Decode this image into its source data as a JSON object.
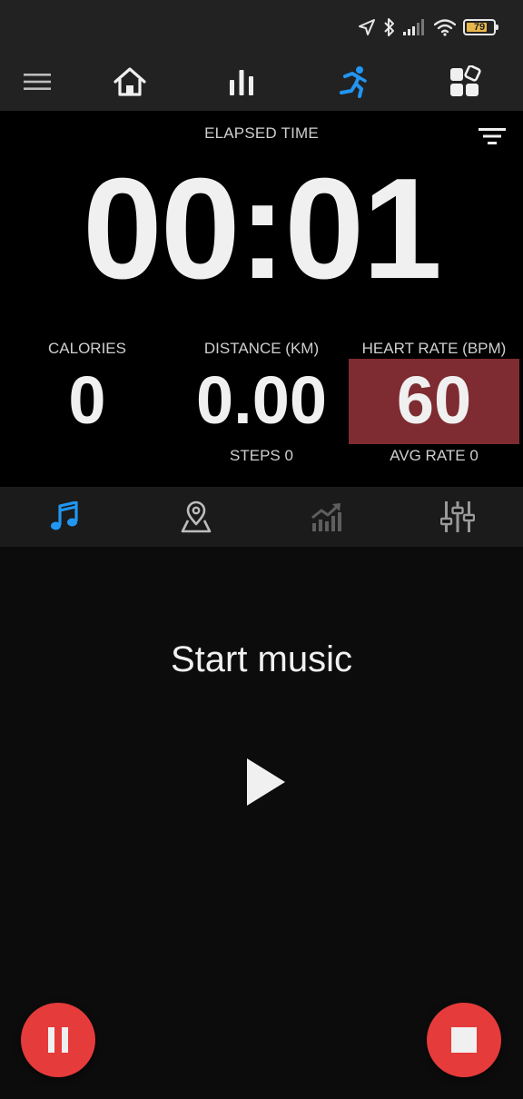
{
  "status_bar": {
    "battery_level": "79",
    "battery_fraction": 0.79,
    "icons": [
      "location-arrow-icon",
      "bluetooth-icon",
      "cell-signal-icon",
      "wifi-icon",
      "battery-icon"
    ]
  },
  "top_nav": {
    "items": [
      {
        "name": "menu",
        "icon": "hamburger-menu-icon",
        "active": false
      },
      {
        "name": "home",
        "icon": "home-icon",
        "active": false
      },
      {
        "name": "stats",
        "icon": "bar-chart-icon",
        "active": false
      },
      {
        "name": "workout",
        "icon": "running-person-icon",
        "active": true
      },
      {
        "name": "widgets",
        "icon": "widgets-icon",
        "active": false
      }
    ]
  },
  "workout": {
    "elapsed_label": "ELAPSED TIME",
    "elapsed_time": "00:01",
    "calories": {
      "label": "CALORIES",
      "value": "0"
    },
    "distance": {
      "label": "DISTANCE (KM)",
      "value": "0.00",
      "sub": "STEPS 0"
    },
    "heart_rate": {
      "label": "HEART RATE (BPM)",
      "value": "60",
      "sub": "AVG RATE 0"
    }
  },
  "tabs": [
    {
      "name": "music",
      "icon": "music-note-icon",
      "active": true
    },
    {
      "name": "map",
      "icon": "map-pin-icon",
      "active": false
    },
    {
      "name": "chart",
      "icon": "trend-chart-icon",
      "active": false
    },
    {
      "name": "settings",
      "icon": "equalizer-sliders-icon",
      "active": false
    }
  ],
  "music": {
    "title": "Start music"
  },
  "colors": {
    "accent_blue": "#2196f3",
    "heart_rate_bg": "#7e2c31",
    "fab_red": "#e53b3b",
    "battery_yellow": "#e8b64a",
    "bar_bg": "#222222"
  }
}
